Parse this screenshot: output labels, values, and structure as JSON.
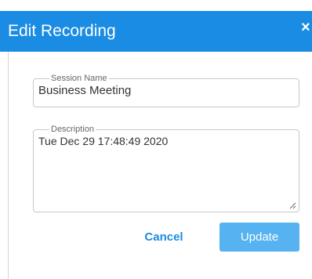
{
  "dialog": {
    "title": "Edit Recording",
    "close_icon": "close-icon",
    "close_glyph": "×"
  },
  "form": {
    "session_name": {
      "label": "Session Name",
      "value": "Business Meeting"
    },
    "description": {
      "label": "Description",
      "value": "Tue Dec 29 17:48:49 2020"
    }
  },
  "actions": {
    "cancel_label": "Cancel",
    "update_label": "Update"
  },
  "colors": {
    "header_bg": "#1a8ce3",
    "primary_button_bg": "#56b2f0",
    "link_text": "#1a8ce3"
  }
}
